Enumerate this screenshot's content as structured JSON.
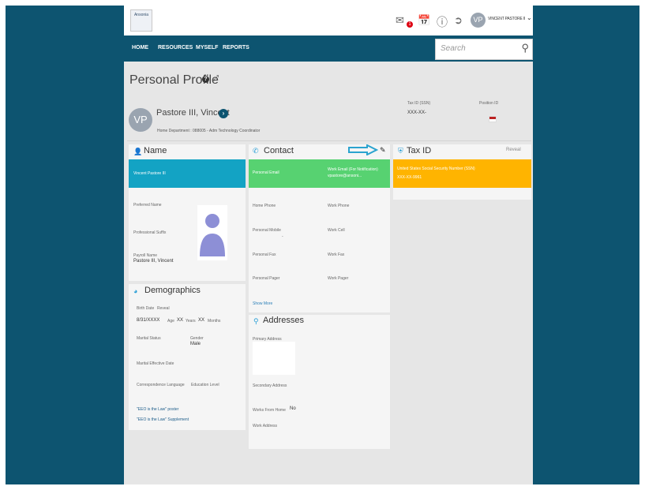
{
  "app": {
    "logo_text": "Ansonia",
    "user_initials": "VP",
    "user_name": "VINCENT PASTORE II",
    "mail_badge": "1"
  },
  "nav": {
    "items": [
      "HOME",
      "RESOURCES",
      "MYSELF",
      "REPORTS"
    ],
    "search_placeholder": "Search"
  },
  "page": {
    "title": "Personal Profile"
  },
  "profile": {
    "initials": "VP",
    "name": "Pastore III, Vincent",
    "department": "Home Department : 088005 - Adm Technology Coordinator",
    "tax_id_label": "Tax ID (SSN)",
    "tax_id_value": "XXX-XX-",
    "position_id_label": "Position ID"
  },
  "name_section": {
    "title": "Name",
    "full_name": "Vincent Pastore III",
    "preferred_name_label": "Preferred Name",
    "professional_suffix_label": "Professional Suffix",
    "payroll_name_label": "Payroll Name",
    "payroll_name_value": "Pastore III, Vincent"
  },
  "demographics": {
    "title": "Demographics",
    "birth_date_label": "Birth Date",
    "reveal": "Reveal",
    "birth_date_value": "8/31/XXXX",
    "age_label": "Age",
    "years_value": "XX",
    "years_label": "Years",
    "months_value": "XX",
    "months_label": "Months",
    "marital_status_label": "Marital Status",
    "gender_label": "Gender",
    "gender_value": "Male",
    "marital_effective_label": "Marital Effective Date",
    "correspondence_label": "Correspondence Language",
    "education_label": "Education Level",
    "eeo_link1": "\"EEO is the Law\" poster",
    "eeo_link2": "\"EEO is the Law\" Supplement"
  },
  "contact": {
    "title": "Contact",
    "personal_email_label": "Personal Email",
    "work_email_label": "Work Email (For Notification)",
    "work_email_value": "vpastore@ansoni...",
    "home_phone_label": "Home Phone",
    "work_phone_label": "Work Phone",
    "personal_mobile_label": "Personal Mobile",
    "personal_mobile_value": "-",
    "work_cell_label": "Work Cell",
    "personal_fax_label": "Personal Fax",
    "work_fax_label": "Work Fax",
    "personal_pager_label": "Personal Pager",
    "work_pager_label": "Work Pager",
    "show_more": "Show More"
  },
  "addresses": {
    "title": "Addresses",
    "primary_label": "Primary Address",
    "secondary_label": "Secondary Address",
    "works_from_home_label": "Works From Home",
    "works_from_home_value": "No",
    "work_address_label": "Work Address"
  },
  "tax": {
    "title": "Tax ID",
    "reveal": "Reveal",
    "ssn_label": "United States Social Security Number (SSN)",
    "ssn_value": "XXX-XX-9961"
  },
  "colors": {
    "dark_teal": "#0d5470",
    "name_band": "#13a3c4",
    "contact_band": "#57d271",
    "tax_band": "#ffb400"
  }
}
